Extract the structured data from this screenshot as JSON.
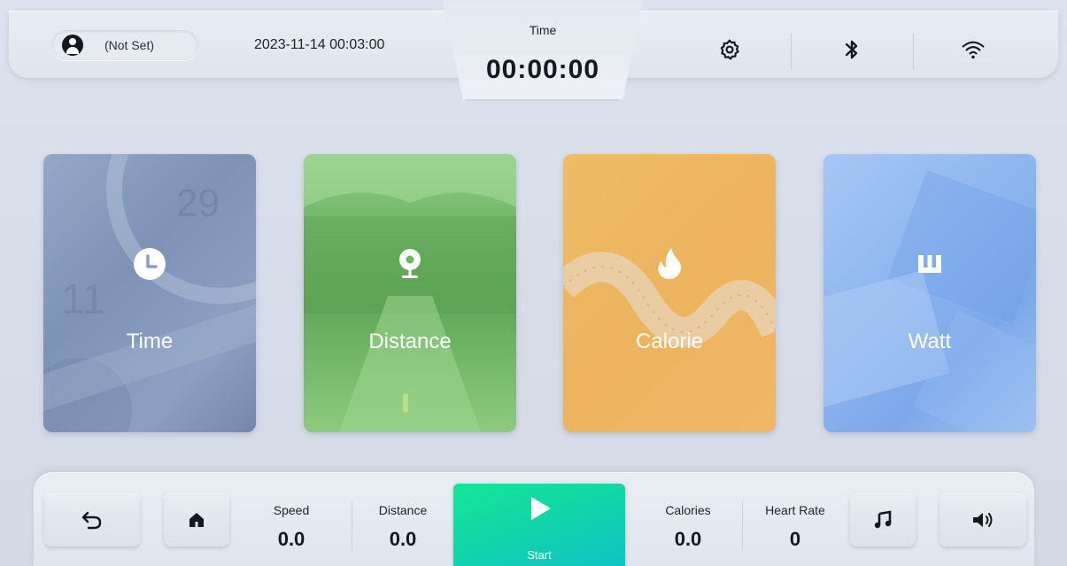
{
  "header": {
    "user_name": "(Not Set)",
    "datetime": "2023-11-14 00:03:00",
    "time_label": "Time",
    "time_value": "00:00:00",
    "icons": [
      "settings-gear-icon",
      "bluetooth-icon",
      "wifi-icon"
    ]
  },
  "modes": [
    {
      "label": "Time",
      "icon": "clock-icon",
      "color": "#8a9dbf"
    },
    {
      "label": "Distance",
      "icon": "location-pin-icon",
      "color": "#6fb464"
    },
    {
      "label": "Calorie",
      "icon": "flame-icon",
      "color": "#eeb45f"
    },
    {
      "label": "Watt",
      "icon": "watt-icon",
      "color": "#8cb5ee"
    }
  ],
  "footer": {
    "back_icon": "back-arrow-icon",
    "home_icon": "home-icon",
    "stats": [
      {
        "label": "Speed",
        "value": "0.0"
      },
      {
        "label": "Distance",
        "value": "0.0"
      },
      {
        "label": "Calories",
        "value": "0.0"
      },
      {
        "label": "Heart Rate",
        "value": "0"
      }
    ],
    "start_label": "Start",
    "start_color": "#12d6a6",
    "music_icon": "music-note-icon",
    "volume_icon": "volume-icon"
  }
}
